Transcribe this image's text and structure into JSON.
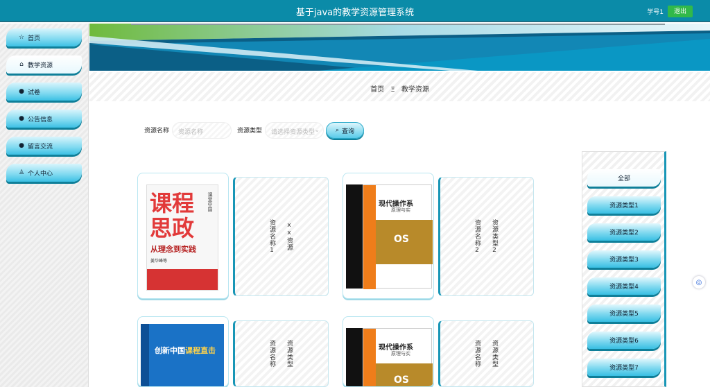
{
  "header": {
    "title": "基于java的教学资源管理系统",
    "user": "学号1",
    "logout": "退出"
  },
  "sidebar": {
    "items": [
      {
        "label": "首页",
        "icon": "star-icon"
      },
      {
        "label": "教学资源",
        "icon": "home-icon"
      },
      {
        "label": "试卷",
        "icon": "info-circle-icon"
      },
      {
        "label": "公告信息",
        "icon": "question-circle-icon"
      },
      {
        "label": "留言交流",
        "icon": "info-circle-icon"
      },
      {
        "label": "个人中心",
        "icon": "user-icon"
      }
    ]
  },
  "breadcrumb": {
    "home": "首页",
    "separator": "Ξ",
    "current": "教学资源"
  },
  "search": {
    "name_label": "资源名称",
    "name_placeholder": "资源名称",
    "type_label": "资源类型",
    "type_placeholder": "请选择资源类型",
    "query_button": "查询"
  },
  "resources": [
    {
      "name": "资源名称1",
      "type": "xx资源",
      "cover_line1": "课程",
      "cover_line2": "思政",
      "cover_sub": "从理念到实践",
      "cover_side": "课堂中国",
      "cover_author": "姜华峰等"
    },
    {
      "name": "资源名称2",
      "type": "资源类型2",
      "cover_title": "现代操作系",
      "cover_sub": "原理与实",
      "cover_badge": "OS"
    },
    {
      "name": "资源名称",
      "type": "资源类型",
      "cover_title": "创新中国",
      "cover_title2": "课程直击"
    },
    {
      "name": "资源名称",
      "type": "资源类型",
      "cover_title": "现代操作系",
      "cover_sub": "原理与实",
      "cover_badge": "OS"
    }
  ],
  "types": {
    "items": [
      "全部",
      "资源类型1",
      "资源类型2",
      "资源类型3",
      "资源类型4",
      "资源类型5",
      "资源类型6",
      "资源类型7"
    ]
  },
  "colors": {
    "header": "#0b8ba8",
    "accent": "#3cc0e4",
    "logout": "#31b94a"
  }
}
